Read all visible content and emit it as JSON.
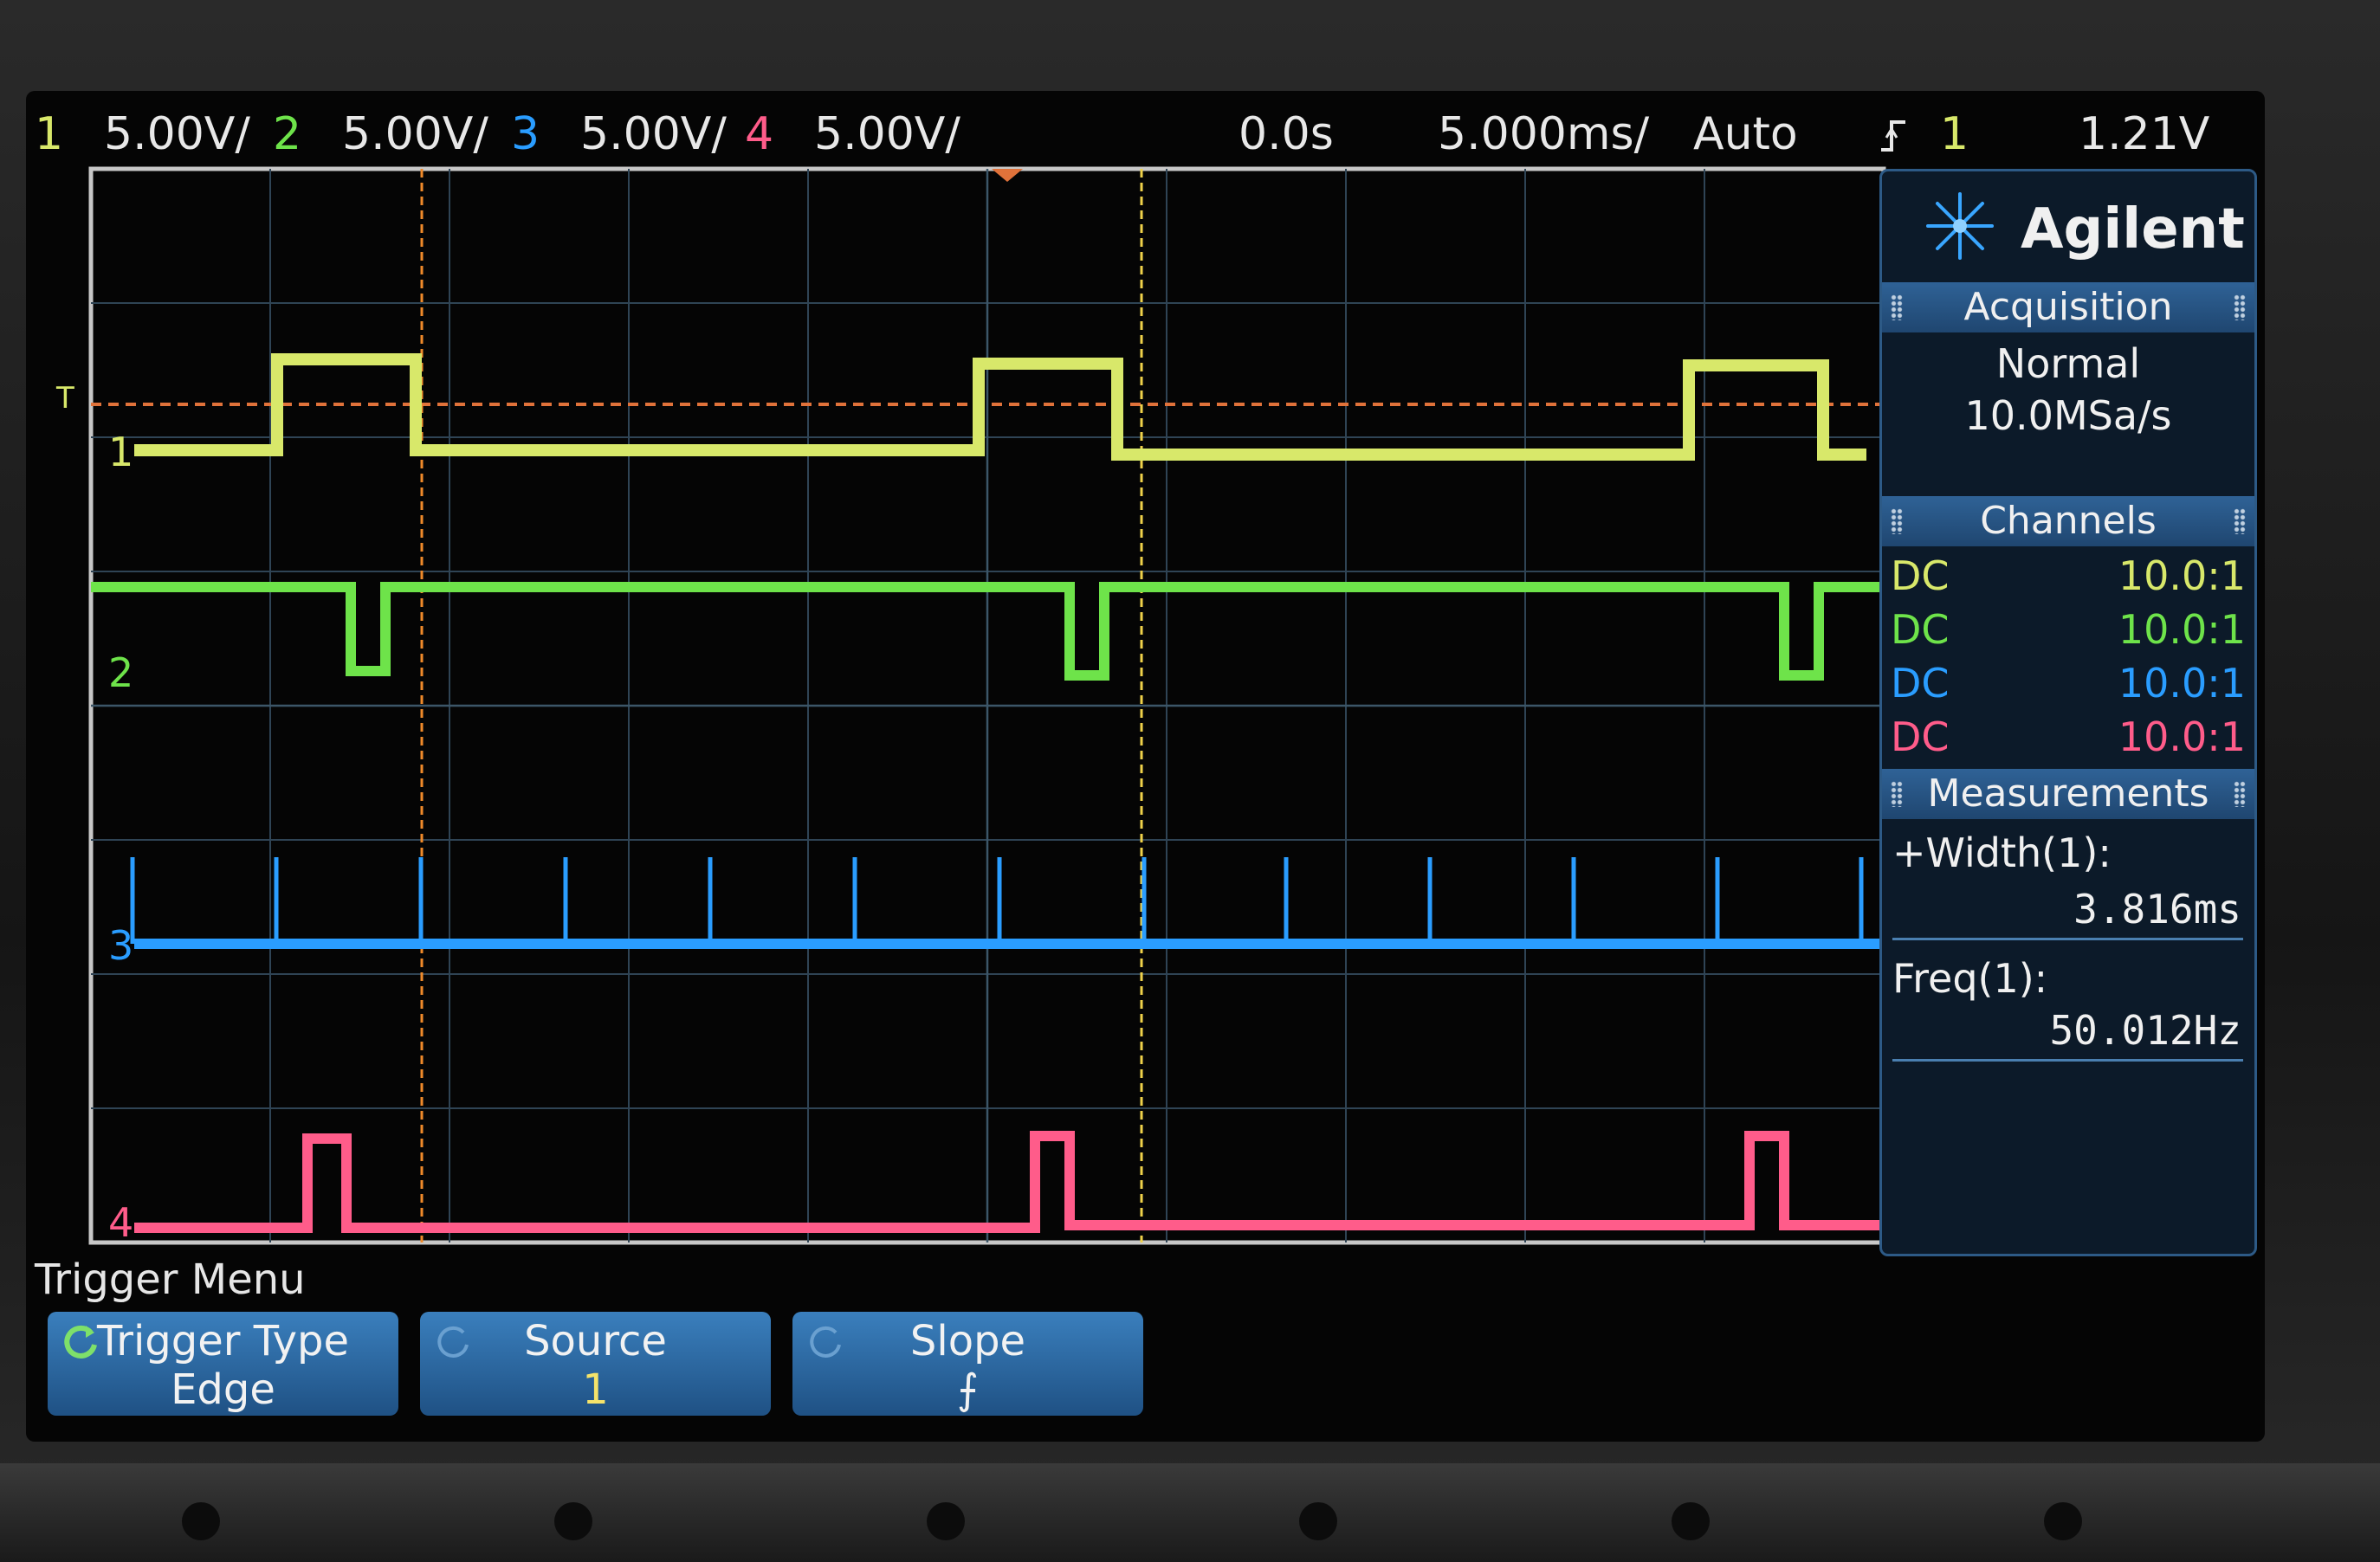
{
  "status_bar": {
    "ch1": {
      "num": "1",
      "scale": "5.00V/",
      "color": "#d8e86a"
    },
    "ch2": {
      "num": "2",
      "scale": "5.00V/",
      "color": "#6ee34a"
    },
    "ch3": {
      "num": "3",
      "scale": "5.00V/",
      "color": "#2a9dff"
    },
    "ch4": {
      "num": "4",
      "scale": "5.00V/",
      "color": "#ff5c8a"
    },
    "delay": "0.0s",
    "timebase": "5.000ms/",
    "trigger_mode": "Auto",
    "trigger_slope_icon": "rising-edge-icon",
    "trigger_source": "1",
    "trigger_level": "1.21V"
  },
  "waveforms": {
    "channel_labels": [
      "1",
      "2",
      "3",
      "4"
    ],
    "marker_labels": {
      "trigger": "T"
    }
  },
  "side_panel": {
    "brand": "Agilent",
    "acquisition": {
      "title": "Acquisition",
      "mode": "Normal",
      "rate": "10.0MSa/s"
    },
    "channels": {
      "title": "Channels",
      "rows": [
        {
          "coupling": "DC",
          "probe": "10.0:1",
          "color": "#d8e86a"
        },
        {
          "coupling": "DC",
          "probe": "10.0:1",
          "color": "#6ee34a"
        },
        {
          "coupling": "DC",
          "probe": "10.0:1",
          "color": "#2a9dff"
        },
        {
          "coupling": "DC",
          "probe": "10.0:1",
          "color": "#ff5c8a"
        }
      ]
    },
    "measurements": {
      "title": "Measurements",
      "items": [
        {
          "label": "+Width(1):",
          "value": "3.816ms"
        },
        {
          "label": "Freq(1):",
          "value": "50.012Hz"
        }
      ]
    }
  },
  "menu": {
    "title": "Trigger Menu",
    "softkeys": [
      {
        "top": "Trigger Type",
        "bottom": "Edge"
      },
      {
        "top": "Source",
        "bottom": "1"
      },
      {
        "top": "Slope",
        "bottom": "⨍"
      }
    ]
  }
}
